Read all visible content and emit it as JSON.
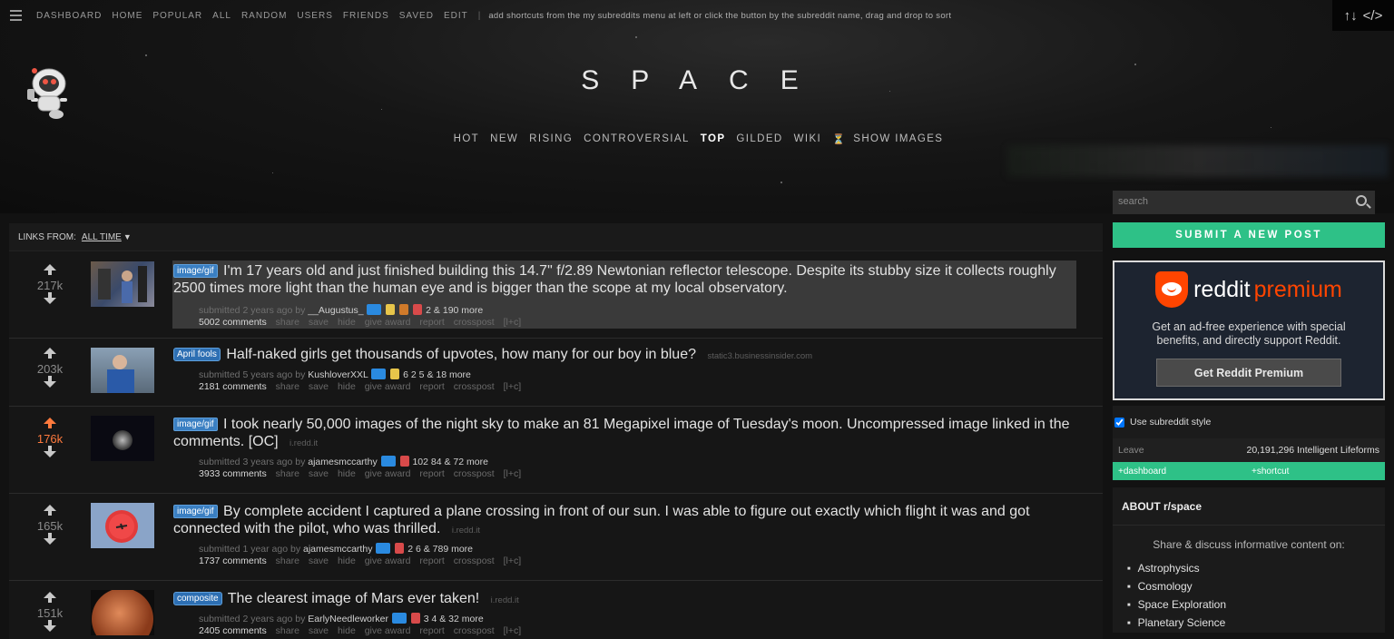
{
  "topbar": {
    "links": [
      "DASHBOARD",
      "HOME",
      "POPULAR",
      "ALL",
      "RANDOM",
      "USERS",
      "FRIENDS",
      "SAVED",
      "EDIT"
    ],
    "separator": "|",
    "hint": "add shortcuts from the my subreddits menu at left or click the button by the subreddit name, drag and drop to sort",
    "sort_icon": "↑↓",
    "code_icon": "</>"
  },
  "site_title": "SPACE",
  "tabs": [
    {
      "label": "HOT",
      "active": false
    },
    {
      "label": "NEW",
      "active": false
    },
    {
      "label": "RISING",
      "active": false
    },
    {
      "label": "CONTROVERSIAL",
      "active": false
    },
    {
      "label": "TOP",
      "active": true
    },
    {
      "label": "GILDED",
      "active": false
    },
    {
      "label": "WIKI",
      "active": false
    },
    {
      "label": "SHOW IMAGES",
      "active": false
    }
  ],
  "listing": {
    "links_from_label": "LINKS FROM:",
    "links_from_value": "ALL TIME"
  },
  "posts": [
    {
      "score": "217k",
      "flair": "image/gif",
      "title": "I'm 17 years old and just finished building this 14.7\" f/2.89 Newtonian reflector telescope. Despite its stubby size it collects roughly 2500 times more light than the human eye and is bigger than the scope at my local observatory.",
      "domain": "",
      "submitted": "submitted 2 years ago by",
      "author": "__Augustus_",
      "awards": "2 & 190 more",
      "comments": "5002 comments"
    },
    {
      "score": "203k",
      "flair": "April fools",
      "title": "Half-naked girls get thousands of upvotes, how many for our boy in blue?",
      "domain": "static3.businessinsider.com",
      "submitted": "submitted 5 years ago by",
      "author": "KushloverXXL",
      "awards": "6  2  5 & 18 more",
      "comments": "2181 comments"
    },
    {
      "score": "176k",
      "flair": "image/gif",
      "title": "I took nearly 50,000 images of the night sky to make an 81 Megapixel image of Tuesday's moon. Uncompressed image linked in the comments. [OC]",
      "domain": "i.redd.it",
      "submitted": "submitted 3 years ago by",
      "author": "ajamesmccarthy",
      "awards": "102  84 & 72 more",
      "comments": "3933 comments"
    },
    {
      "score": "165k",
      "flair": "image/gif",
      "title": "By complete accident I captured a plane crossing in front of our sun. I was able to figure out exactly which flight it was and got connected with the pilot, who was thrilled.",
      "domain": "i.redd.it",
      "submitted": "submitted 1 year ago by",
      "author": "ajamesmccarthy",
      "awards": "2  6 & 789 more",
      "comments": "1737 comments"
    },
    {
      "score": "151k",
      "flair": "composite",
      "title": "The clearest image of Mars ever taken!",
      "domain": "i.redd.it",
      "submitted": "submitted 2 years ago by",
      "author": "EarlyNeedleworker",
      "awards": "3  4 & 32 more",
      "comments": "2405 comments"
    }
  ],
  "post_actions": [
    "share",
    "save",
    "hide",
    "give award",
    "report",
    "crosspost",
    "[l+c]"
  ],
  "sidebar": {
    "search_placeholder": "search",
    "submit_label": "SUBMIT A NEW POST",
    "premium_word1": "reddit",
    "premium_word2": "premium",
    "premium_text": "Get an ad-free experience with special benefits, and directly support Reddit.",
    "premium_button": "Get Reddit Premium",
    "use_style_label": "Use subreddit style",
    "leave_label": "Leave",
    "subscribers": "20,191,296 Intelligent Lifeforms",
    "dashboard_label": "+dashboard",
    "shortcut_label": "+shortcut",
    "about_title": "ABOUT r/space",
    "about_desc": "Share & discuss informative content on:",
    "topics": [
      "Astrophysics",
      "Cosmology",
      "Space Exploration",
      "Planetary Science"
    ]
  },
  "colors": {
    "accent_green": "#2ec187",
    "upvote_orange": "#ff7a3d",
    "flair_blue": "#3a7fc2",
    "reddit_orange": "#ff4500"
  }
}
